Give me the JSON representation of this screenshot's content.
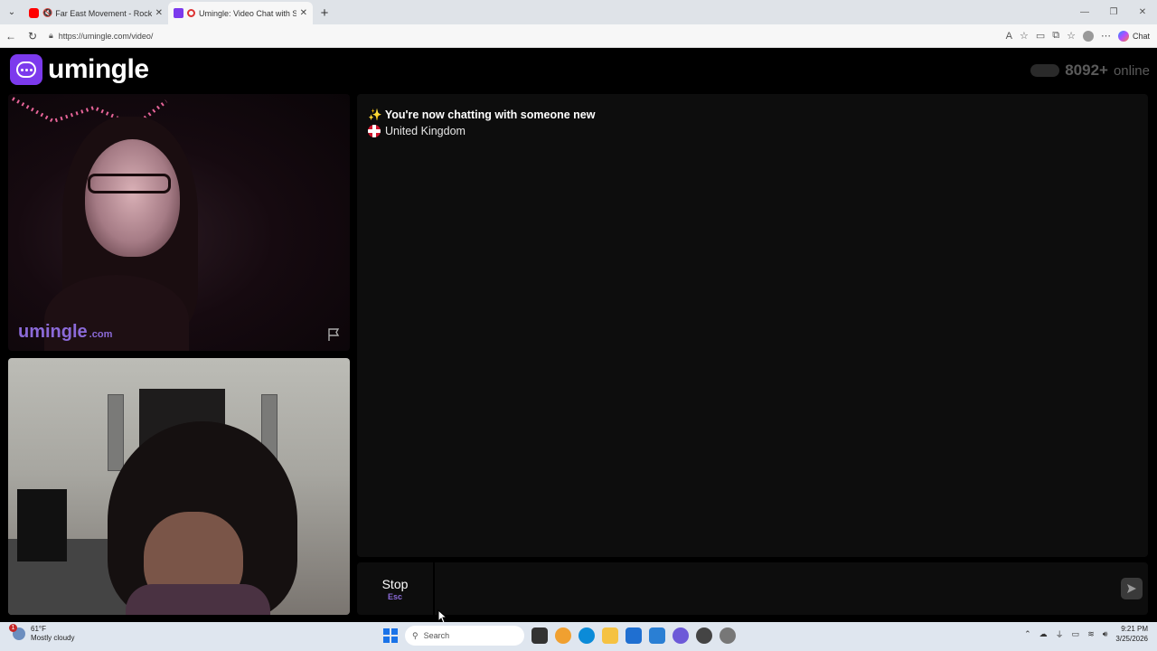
{
  "browser": {
    "tabs": [
      {
        "title": "Far East Movement - Rocketeer",
        "active": false,
        "favicon": "youtube-icon",
        "muted": true
      },
      {
        "title": "Umingle: Video Chat with Strangers",
        "active": true,
        "favicon": "umingle-icon"
      }
    ],
    "url": "https://umingle.com/video/",
    "chat_label": "Chat"
  },
  "site": {
    "logo_text": "umingle",
    "online_count": "8092+",
    "online_label": "online",
    "watermark": "umingle",
    "watermark_suffix": ".com",
    "chat_messages": [
      {
        "icon": "✨",
        "text": "You're now chatting with someone new"
      },
      {
        "icon": "uk-flag-icon",
        "text": "United Kingdom"
      }
    ],
    "stop_label": "Stop",
    "stop_key": "Esc",
    "message_placeholder": "",
    "accent_color": "#7c3aed"
  },
  "taskbar": {
    "temperature": "61°F",
    "weather": "Mostly cloudy",
    "weather_badge": "1",
    "search_placeholder": "Search",
    "time": "9:21 PM",
    "date": "3/25/2026"
  }
}
